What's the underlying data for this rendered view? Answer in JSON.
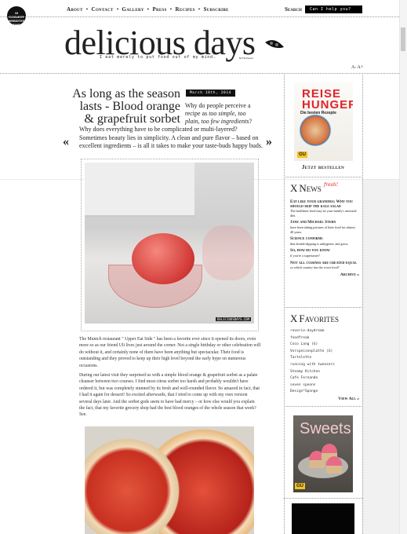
{
  "badge": {
    "text": "10 COOLEST WEBSITES TIME"
  },
  "nav": {
    "items": [
      "About",
      "Contact",
      "Gallery",
      "Press",
      "Recipes",
      "Subscribe"
    ],
    "search_label": "Search",
    "search_placeholder": "Can I help you?"
  },
  "header": {
    "logo": "delicious days",
    "tagline": "I eat merely to put food out of my mind.",
    "tagline_author": "N.F.Simpson",
    "font_size": "A- A+"
  },
  "post": {
    "title": "As long as the season lasts - Blood orange & grapefruit sorbet",
    "date": "March 18th, 2014",
    "teaser_a": "Why do people perceive a recipe as ",
    "teaser_em": "too simple, too plain, too few ingredients",
    "teaser_b": "?",
    "teaser_rest": "Why does everything have to be complicated or multi-layered? Sometimes beauty lies in simplicity. A clean and pure flavor – based on excellent ingredients – is all it takes to make your taste-buds happy buds.",
    "prev": "«",
    "next": "»",
    "watermark": "DELICIOUSDAYS.COM",
    "paragraphs": [
      "The Munich restaurant \" Upper Eat Side \" has been a favorite ever since it opened its doors, even more so as our friend Uli lives just around the corner. Not a single birthday or other celebration will do without it, and certainly none of them have been anything but spectacular. Their food is outstanding and they proved to keep up their high level beyond the early hype on numerous occasions.",
      "During our latest visit they surprised us with a simple blood orange & grapefruit sorbet as a palate cleanser between two courses. I find most citrus sorbet too harsh and probably wouldn't have ordered it, but was completely stunned by its fresh and well-rounded flavor. So amazed in fact, that I had it again for dessert! So excited afterwards, that I tried to come up with my own version several days later. And the sorbet gods seem to have had mercy – or how else would you explain the fact, that my favorite grocery shop had the best blood oranges of the whole season that week? See."
    ]
  },
  "sidebar": {
    "book": {
      "title": "REISE HUNGER",
      "subtitle": "Die besten Rezepte",
      "publisher": "GU",
      "cta": "Jetzt bestellen"
    },
    "news": {
      "x": "X",
      "title": "News",
      "badge": "fresh!",
      "items": [
        {
          "head": "Eat like your grandma: Why you should skip the kale salad",
          "text": "The healthiest food may be your family's ancestral diet."
        },
        {
          "head": "Jane and Michael Stern",
          "text": "have been taking pictures of their food for almost 40 years."
        },
        {
          "head": "Science confirms",
          "text": "that double-dipping is unhygienic and gross."
        },
        {
          "head": "So, how do you know",
          "text": "if you're a supertaster?"
        },
        {
          "head": "Not all cuisines are created equal",
          "text": "so which country has the worst food?"
        }
      ],
      "archive": "Archive »"
    },
    "favorites": {
      "x": "X",
      "title": "Favorites",
      "items": [
        "reverie-daydream",
        "foodfreak",
        "Coco Lang (G)",
        "Vorspeisenplatte (G)",
        "Tartelette",
        "running with tweezers",
        "Steamy Kitchen",
        "Cafe Fernando",
        "seven spoons",
        "Design*Sponge"
      ],
      "view_all": "View All »"
    },
    "sweets": {
      "title": "Sweets",
      "publisher": "GU"
    }
  }
}
